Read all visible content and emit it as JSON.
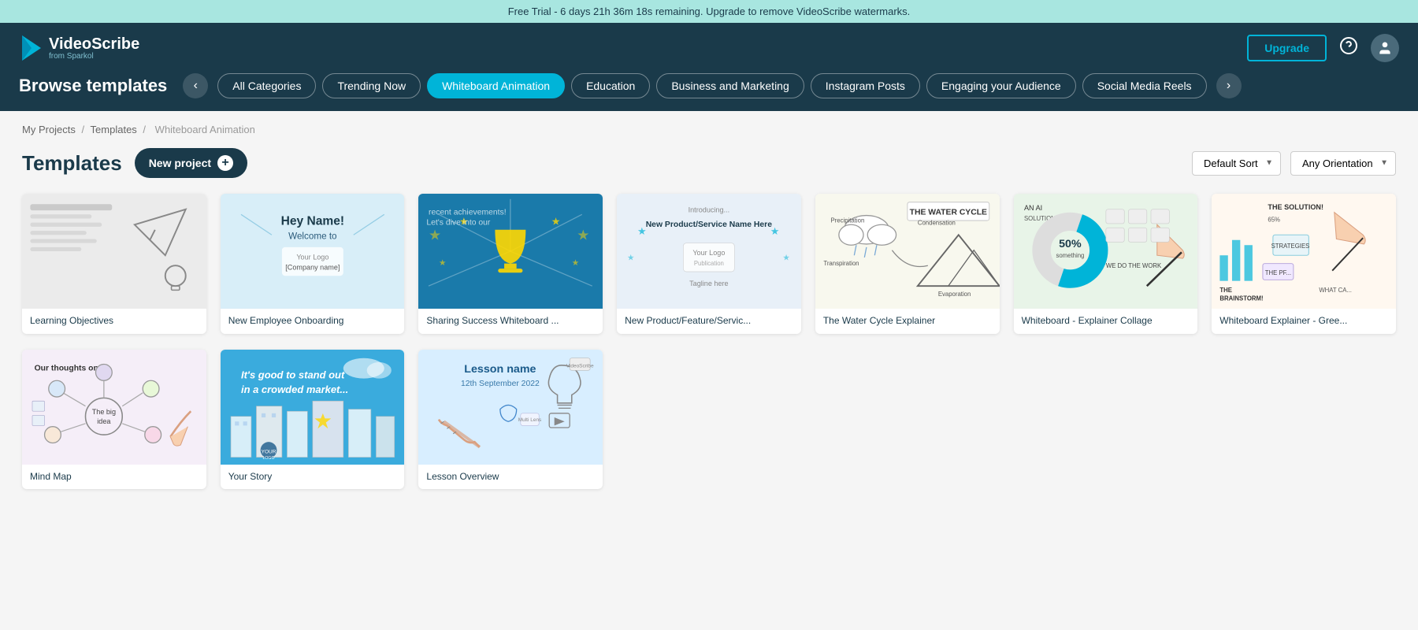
{
  "banner": {
    "text": "Free Trial - 6 days 21h 36m 18s remaining. Upgrade to remove VideoScribe watermarks.",
    "upgrade_link": "Upgrade"
  },
  "header": {
    "logo_name": "VideoScribe",
    "logo_sub": "from Sparkol",
    "upgrade_label": "Upgrade",
    "help_icon": "?",
    "user_icon": "👤"
  },
  "browse": {
    "title": "Browse templates",
    "categories": [
      {
        "label": "All Categories",
        "active": false
      },
      {
        "label": "Trending Now",
        "active": false
      },
      {
        "label": "Whiteboard Animation",
        "active": true
      },
      {
        "label": "Education",
        "active": false
      },
      {
        "label": "Business and Marketing",
        "active": false
      },
      {
        "label": "Instagram Posts",
        "active": false
      },
      {
        "label": "Engaging your Audience",
        "active": false
      },
      {
        "label": "Social Media Reels",
        "active": false
      }
    ]
  },
  "breadcrumb": {
    "parts": [
      "My Projects",
      "Templates",
      "Whiteboard Animation"
    ]
  },
  "templates_section": {
    "title": "Templates",
    "new_project_label": "New project",
    "plus_symbol": "+",
    "sort_label": "Default Sort",
    "orientation_label": "Any Orientation"
  },
  "templates": [
    {
      "id": "learning-objectives",
      "name": "Learning Objectives",
      "thumb_type": "sketch",
      "bg": "#f0eff0"
    },
    {
      "id": "new-employee-onboarding",
      "name": "New Employee Onboarding",
      "thumb_type": "onboarding",
      "bg": "#daeef5"
    },
    {
      "id": "sharing-success",
      "name": "Sharing Success Whiteboard ...",
      "thumb_type": "success",
      "bg": "#c8e4f0"
    },
    {
      "id": "new-product",
      "name": "New Product/Feature/Servic...",
      "thumb_type": "product",
      "bg": "#ddeeff"
    },
    {
      "id": "water-cycle",
      "name": "The Water Cycle Explainer",
      "thumb_type": "water",
      "bg": "#f5f5e8"
    },
    {
      "id": "whiteboard-explainer",
      "name": "Whiteboard - Explainer Collage",
      "thumb_type": "explainer",
      "bg": "#e8f5e8"
    },
    {
      "id": "whiteboard-explainer-green",
      "name": "Whiteboard Explainer - Gree...",
      "thumb_type": "brainstorm",
      "bg": "#fff5e8"
    },
    {
      "id": "mind-map",
      "name": "Mind Map",
      "thumb_type": "mindmap",
      "bg": "#f5eef8"
    },
    {
      "id": "your-story",
      "name": "Your Story",
      "thumb_type": "story",
      "bg": "#c8e0f8"
    },
    {
      "id": "lesson-overview",
      "name": "Lesson Overview",
      "thumb_type": "lesson",
      "bg": "#d8eeff"
    }
  ],
  "icons": {
    "arrow_left": "‹",
    "arrow_right": "›",
    "dropdown_arrow": "▾"
  }
}
